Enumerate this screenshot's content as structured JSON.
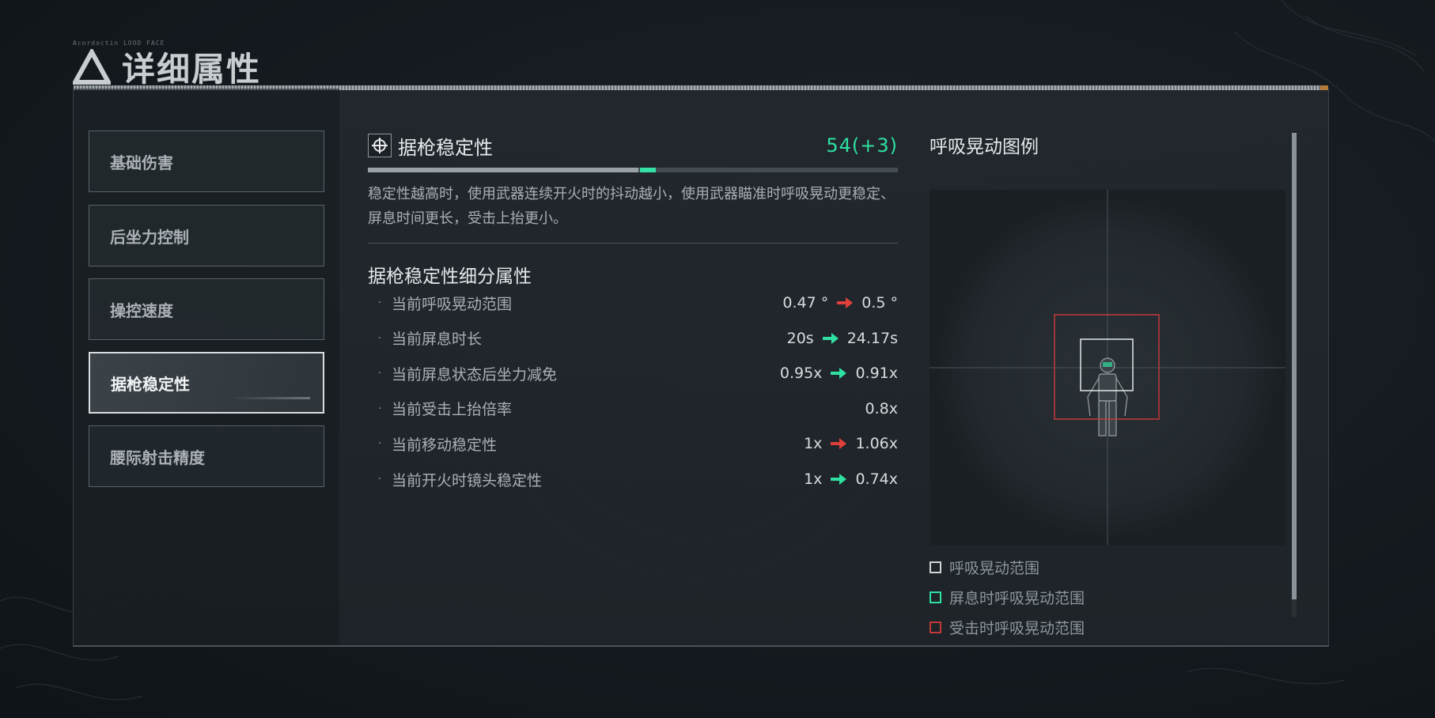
{
  "header": {
    "tiny_text": "Acordoctin LOOD FACE",
    "title": "详细属性",
    "logo_icon": "delta-logo-icon"
  },
  "sidebar": {
    "items": [
      {
        "label": "基础伤害",
        "active": false
      },
      {
        "label": "后坐力控制",
        "active": false
      },
      {
        "label": "操控速度",
        "active": false
      },
      {
        "label": "据枪稳定性",
        "active": true
      },
      {
        "label": "腰际射击精度",
        "active": false
      }
    ]
  },
  "stat": {
    "icon": "crosshair-icon",
    "name": "据枪稳定性",
    "value": "54(+3)",
    "bar_base_fraction": 0.51,
    "bar_bonus_fraction": 0.03,
    "description": "稳定性越高时，使用武器连续开火时的抖动越小，使用武器瞄准时呼吸晃动更稳定、屏息时间更长，受击上抬更小。",
    "breakdown_title": "据枪稳定性细分属性",
    "rows": [
      {
        "label": "当前呼吸晃动范围",
        "from": "0.47 °",
        "arrow": "red",
        "to": "0.5 °"
      },
      {
        "label": "当前屏息时长",
        "from": "20s",
        "arrow": "green",
        "to": "24.17s"
      },
      {
        "label": "当前屏息状态后坐力减免",
        "from": "0.95x",
        "arrow": "green",
        "to": "0.91x"
      },
      {
        "label": "当前受击上抬倍率",
        "from": "",
        "arrow": "",
        "to": "0.8x"
      },
      {
        "label": "当前移动稳定性",
        "from": "1x",
        "arrow": "red",
        "to": "1.06x"
      },
      {
        "label": "当前开火时镜头稳定性",
        "from": "1x",
        "arrow": "green",
        "to": "0.74x"
      }
    ]
  },
  "legend": {
    "title": "呼吸晃动图例",
    "items": [
      {
        "label": "呼吸晃动范围",
        "color": "#d0d4d7"
      },
      {
        "label": "屏息时呼吸晃动范围",
        "color": "#2fe0a0"
      },
      {
        "label": "受击时呼吸晃动范围",
        "color": "#c03a3a"
      }
    ]
  },
  "colors": {
    "accent_green": "#2fe0a0",
    "accent_red": "#e0403a",
    "panel_bg": "#242a2f"
  }
}
